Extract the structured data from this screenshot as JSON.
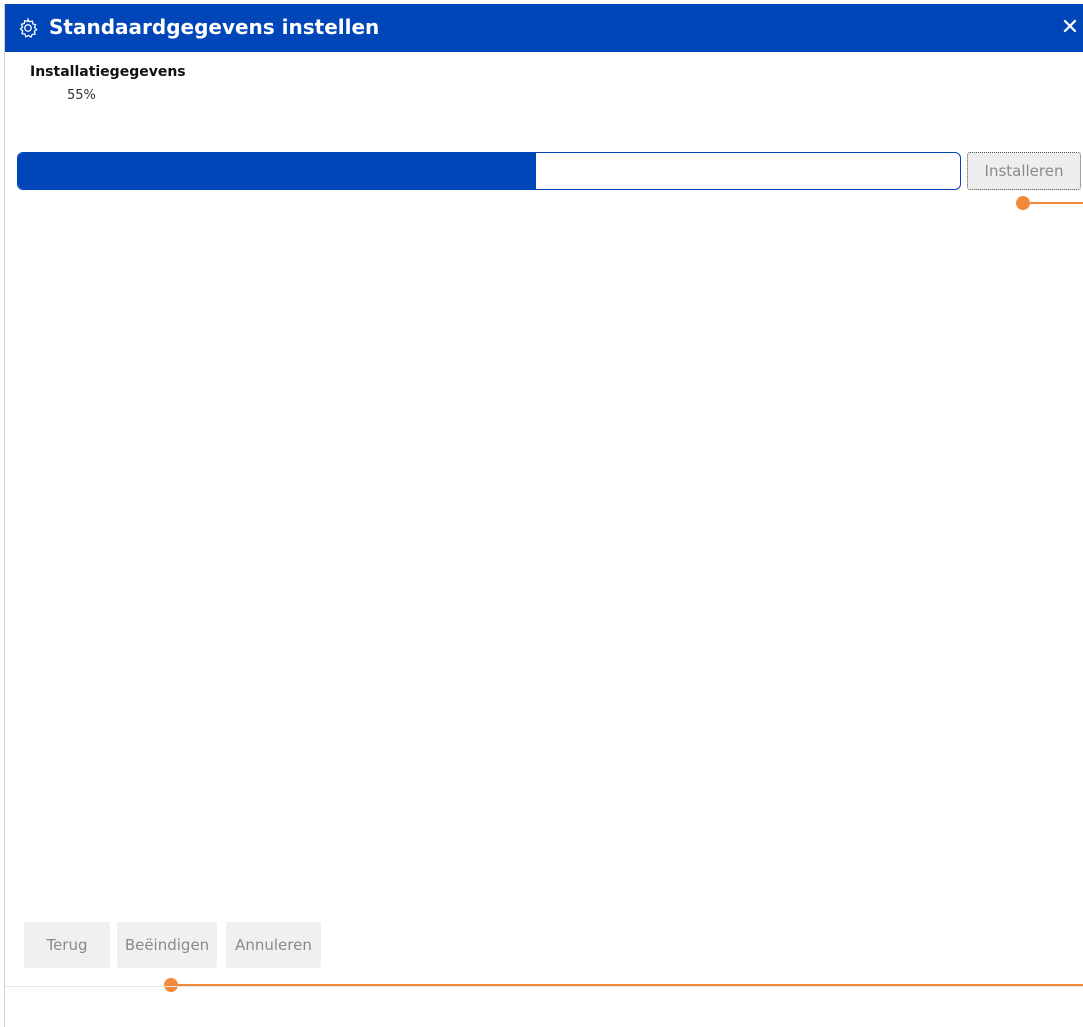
{
  "window": {
    "title": "Standaardgegevens instellen",
    "close_glyph": "✕",
    "title_icon": "gear-icon"
  },
  "section": {
    "title": "Installatiegegevens",
    "percent_label": "55%"
  },
  "progress": {
    "value": 0.55
  },
  "buttons": {
    "install_label": "Installeren",
    "back_label": "Terug",
    "finish_label": "Beëindigen",
    "cancel_label": "Annuleren"
  },
  "colors": {
    "accent": "#0046b8",
    "callout": "#f08a3a",
    "disabled_text": "#8a8a8a"
  }
}
